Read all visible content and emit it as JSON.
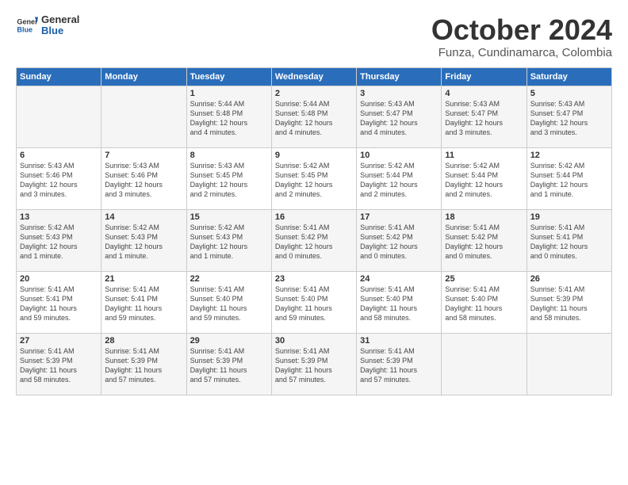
{
  "header": {
    "logo_general": "General",
    "logo_blue": "Blue",
    "month": "October 2024",
    "location": "Funza, Cundinamarca, Colombia"
  },
  "weekdays": [
    "Sunday",
    "Monday",
    "Tuesday",
    "Wednesday",
    "Thursday",
    "Friday",
    "Saturday"
  ],
  "weeks": [
    [
      {
        "day": "",
        "detail": ""
      },
      {
        "day": "",
        "detail": ""
      },
      {
        "day": "1",
        "detail": "Sunrise: 5:44 AM\nSunset: 5:48 PM\nDaylight: 12 hours\nand 4 minutes."
      },
      {
        "day": "2",
        "detail": "Sunrise: 5:44 AM\nSunset: 5:48 PM\nDaylight: 12 hours\nand 4 minutes."
      },
      {
        "day": "3",
        "detail": "Sunrise: 5:43 AM\nSunset: 5:47 PM\nDaylight: 12 hours\nand 4 minutes."
      },
      {
        "day": "4",
        "detail": "Sunrise: 5:43 AM\nSunset: 5:47 PM\nDaylight: 12 hours\nand 3 minutes."
      },
      {
        "day": "5",
        "detail": "Sunrise: 5:43 AM\nSunset: 5:47 PM\nDaylight: 12 hours\nand 3 minutes."
      }
    ],
    [
      {
        "day": "6",
        "detail": "Sunrise: 5:43 AM\nSunset: 5:46 PM\nDaylight: 12 hours\nand 3 minutes."
      },
      {
        "day": "7",
        "detail": "Sunrise: 5:43 AM\nSunset: 5:46 PM\nDaylight: 12 hours\nand 3 minutes."
      },
      {
        "day": "8",
        "detail": "Sunrise: 5:43 AM\nSunset: 5:45 PM\nDaylight: 12 hours\nand 2 minutes."
      },
      {
        "day": "9",
        "detail": "Sunrise: 5:42 AM\nSunset: 5:45 PM\nDaylight: 12 hours\nand 2 minutes."
      },
      {
        "day": "10",
        "detail": "Sunrise: 5:42 AM\nSunset: 5:44 PM\nDaylight: 12 hours\nand 2 minutes."
      },
      {
        "day": "11",
        "detail": "Sunrise: 5:42 AM\nSunset: 5:44 PM\nDaylight: 12 hours\nand 2 minutes."
      },
      {
        "day": "12",
        "detail": "Sunrise: 5:42 AM\nSunset: 5:44 PM\nDaylight: 12 hours\nand 1 minute."
      }
    ],
    [
      {
        "day": "13",
        "detail": "Sunrise: 5:42 AM\nSunset: 5:43 PM\nDaylight: 12 hours\nand 1 minute."
      },
      {
        "day": "14",
        "detail": "Sunrise: 5:42 AM\nSunset: 5:43 PM\nDaylight: 12 hours\nand 1 minute."
      },
      {
        "day": "15",
        "detail": "Sunrise: 5:42 AM\nSunset: 5:43 PM\nDaylight: 12 hours\nand 1 minute."
      },
      {
        "day": "16",
        "detail": "Sunrise: 5:41 AM\nSunset: 5:42 PM\nDaylight: 12 hours\nand 0 minutes."
      },
      {
        "day": "17",
        "detail": "Sunrise: 5:41 AM\nSunset: 5:42 PM\nDaylight: 12 hours\nand 0 minutes."
      },
      {
        "day": "18",
        "detail": "Sunrise: 5:41 AM\nSunset: 5:42 PM\nDaylight: 12 hours\nand 0 minutes."
      },
      {
        "day": "19",
        "detail": "Sunrise: 5:41 AM\nSunset: 5:41 PM\nDaylight: 12 hours\nand 0 minutes."
      }
    ],
    [
      {
        "day": "20",
        "detail": "Sunrise: 5:41 AM\nSunset: 5:41 PM\nDaylight: 11 hours\nand 59 minutes."
      },
      {
        "day": "21",
        "detail": "Sunrise: 5:41 AM\nSunset: 5:41 PM\nDaylight: 11 hours\nand 59 minutes."
      },
      {
        "day": "22",
        "detail": "Sunrise: 5:41 AM\nSunset: 5:40 PM\nDaylight: 11 hours\nand 59 minutes."
      },
      {
        "day": "23",
        "detail": "Sunrise: 5:41 AM\nSunset: 5:40 PM\nDaylight: 11 hours\nand 59 minutes."
      },
      {
        "day": "24",
        "detail": "Sunrise: 5:41 AM\nSunset: 5:40 PM\nDaylight: 11 hours\nand 58 minutes."
      },
      {
        "day": "25",
        "detail": "Sunrise: 5:41 AM\nSunset: 5:40 PM\nDaylight: 11 hours\nand 58 minutes."
      },
      {
        "day": "26",
        "detail": "Sunrise: 5:41 AM\nSunset: 5:39 PM\nDaylight: 11 hours\nand 58 minutes."
      }
    ],
    [
      {
        "day": "27",
        "detail": "Sunrise: 5:41 AM\nSunset: 5:39 PM\nDaylight: 11 hours\nand 58 minutes."
      },
      {
        "day": "28",
        "detail": "Sunrise: 5:41 AM\nSunset: 5:39 PM\nDaylight: 11 hours\nand 57 minutes."
      },
      {
        "day": "29",
        "detail": "Sunrise: 5:41 AM\nSunset: 5:39 PM\nDaylight: 11 hours\nand 57 minutes."
      },
      {
        "day": "30",
        "detail": "Sunrise: 5:41 AM\nSunset: 5:39 PM\nDaylight: 11 hours\nand 57 minutes."
      },
      {
        "day": "31",
        "detail": "Sunrise: 5:41 AM\nSunset: 5:39 PM\nDaylight: 11 hours\nand 57 minutes."
      },
      {
        "day": "",
        "detail": ""
      },
      {
        "day": "",
        "detail": ""
      }
    ]
  ]
}
